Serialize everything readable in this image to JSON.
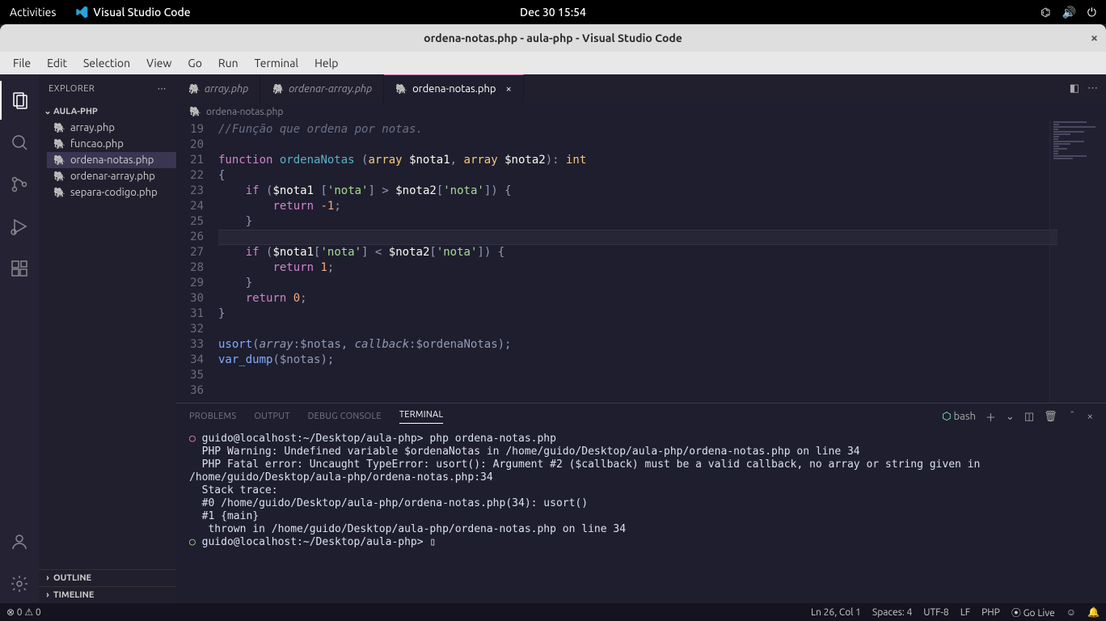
{
  "gnome": {
    "activities": "Activities",
    "app": "Visual Studio Code",
    "clock": "Dec 30  15:54"
  },
  "titlebar": "ordena-notas.php - aula-php - Visual Studio Code",
  "menu": [
    "File",
    "Edit",
    "Selection",
    "View",
    "Go",
    "Run",
    "Terminal",
    "Help"
  ],
  "explorer": {
    "title": "EXPLORER",
    "folder": "AULA-PHP",
    "files": [
      "array.php",
      "funcao.php",
      "ordena-notas.php",
      "ordenar-array.php",
      "separa-codigo.php"
    ],
    "active": "ordena-notas.php",
    "outline": "OUTLINE",
    "timeline": "TIMELINE"
  },
  "tabs": [
    {
      "label": "array.php",
      "active": false
    },
    {
      "label": "ordenar-array.php",
      "active": false
    },
    {
      "label": "ordena-notas.php",
      "active": true
    }
  ],
  "breadcrumb": "ordena-notas.php",
  "lines": [
    19,
    20,
    21,
    22,
    23,
    24,
    25,
    26,
    27,
    28,
    29,
    30,
    31,
    32,
    33,
    34,
    35,
    36
  ],
  "code": {
    "l19": "//Função que ordena por notas.",
    "l33_a": "usort(",
    "l33_b": "array",
    "l33_c": ":$notas, ",
    "l33_d": "callback",
    "l33_e": ":$ordenaNotas);",
    "l34": "var_dump",
    "l34b": "($notas);"
  },
  "panel_tabs": [
    "PROBLEMS",
    "OUTPUT",
    "DEBUG CONSOLE",
    "TERMINAL"
  ],
  "panel_active": "TERMINAL",
  "shell_name": "bash",
  "terminal": [
    {
      "sym": "err",
      "text": "guido@localhost:~/Desktop/aula-php> php ordena-notas.php"
    },
    {
      "sym": "",
      "text": "PHP Warning:  Undefined variable $ordenaNotas in /home/guido/Desktop/aula-php/ordena-notas.php on line 34"
    },
    {
      "sym": "",
      "text": "PHP Fatal error:  Uncaught TypeError: usort(): Argument #2 ($callback) must be a valid callback, no array or string given in /home/guido/Desktop/aula-php/ordena-notas.php:34"
    },
    {
      "sym": "",
      "text": "Stack trace:"
    },
    {
      "sym": "",
      "text": "#0 /home/guido/Desktop/aula-php/ordena-notas.php(34): usort()"
    },
    {
      "sym": "",
      "text": "#1 {main}"
    },
    {
      "sym": "",
      "text": "  thrown in /home/guido/Desktop/aula-php/ordena-notas.php on line 34"
    },
    {
      "sym": "ok",
      "text": "guido@localhost:~/Desktop/aula-php> ▯"
    }
  ],
  "status": {
    "errors": "⊗ 0 ⚠ 0",
    "cursor": "Ln 26, Col 1",
    "spaces": "Spaces: 4",
    "encoding": "UTF-8",
    "eol": "LF",
    "lang": "PHP",
    "golive": "⦿ Go Live"
  }
}
